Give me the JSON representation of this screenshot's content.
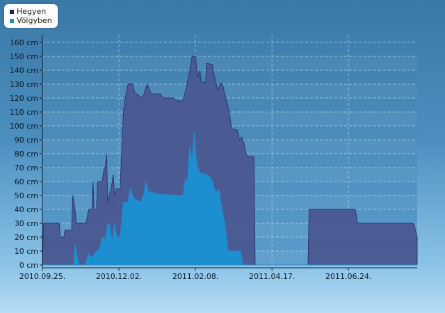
{
  "colors": {
    "hegyen": "#4a5790",
    "hegyen_line": "#2c3670",
    "volgyben": "#1d8fd0",
    "legend_hegyen": "#1a2260",
    "legend_volgyben": "#1d8fd0"
  },
  "legend": [
    {
      "name": "Hegyen",
      "color_key": "legend_hegyen"
    },
    {
      "name": "Völgyben",
      "color_key": "legend_volgyben"
    }
  ],
  "chart_data": {
    "type": "area",
    "ylim": [
      0,
      160
    ],
    "y_ticks": [
      0,
      10,
      20,
      30,
      40,
      50,
      60,
      70,
      80,
      90,
      100,
      110,
      120,
      130,
      140,
      150,
      160
    ],
    "y_tick_labels": [
      "0 cm",
      "10 cm",
      "20 cm",
      "30 cm",
      "40 cm",
      "50 cm",
      "60 cm",
      "70 cm",
      "80 cm",
      "90 cm",
      "100 cm",
      "110 cm",
      "120 cm",
      "130 cm",
      "140 cm",
      "150 cm",
      "160 cm"
    ],
    "x_tick_labels": [
      "2010.09.25.",
      "2010.12.02.",
      "2011.02.08.",
      "2011.04.17.",
      "2011.06.24."
    ],
    "x_range": [
      "2010.09.25.",
      "2011.08.24."
    ],
    "grid": true,
    "legend_position": "top-left",
    "series": [
      {
        "name": "Hegyen",
        "points": [
          [
            "2010.09.25.",
            0
          ],
          [
            "2010.09.26.",
            30
          ],
          [
            "2010.10.10.",
            30
          ],
          [
            "2010.10.11.",
            20
          ],
          [
            "2010.10.14.",
            20
          ],
          [
            "2010.10.15.",
            25
          ],
          [
            "2010.10.21.",
            25
          ],
          [
            "2010.10.22.",
            50
          ],
          [
            "2010.10.24.",
            40
          ],
          [
            "2010.10.25.",
            30
          ],
          [
            "2010.11.03.",
            30
          ],
          [
            "2010.11.05.",
            40
          ],
          [
            "2010.11.08.",
            40
          ],
          [
            "2010.11.09.",
            60
          ],
          [
            "2010.11.10.",
            40
          ],
          [
            "2010.11.12.",
            40
          ],
          [
            "2010.11.13.",
            60
          ],
          [
            "2010.11.17.",
            60
          ],
          [
            "2010.11.19.",
            70
          ],
          [
            "2010.11.20.",
            70
          ],
          [
            "2010.11.21.",
            80
          ],
          [
            "2010.11.22.",
            45
          ],
          [
            "2010.11.25.",
            55
          ],
          [
            "2010.11.27.",
            65
          ],
          [
            "2010.11.28.",
            50
          ],
          [
            "2010.11.30.",
            55
          ],
          [
            "2010.12.03.",
            55
          ],
          [
            "2010.12.06.",
            110
          ],
          [
            "2010.12.08.",
            122
          ],
          [
            "2010.12.10.",
            130
          ],
          [
            "2010.12.14.",
            130
          ],
          [
            "2010.12.16.",
            124
          ],
          [
            "2010.12.23.",
            120
          ],
          [
            "2010.12.25.",
            125
          ],
          [
            "2010.12.27.",
            130
          ],
          [
            "2010.12.29.",
            126
          ],
          [
            "2010.12.31.",
            123
          ],
          [
            "2011.01.08.",
            123
          ],
          [
            "2011.01.10.",
            120
          ],
          [
            "2011.01.20.",
            120
          ],
          [
            "2011.01.22.",
            118
          ],
          [
            "2011.01.28.",
            118
          ],
          [
            "2011.01.31.",
            128
          ],
          [
            "2011.02.03.",
            140
          ],
          [
            "2011.02.05.",
            150
          ],
          [
            "2011.02.08.",
            150
          ],
          [
            "2011.02.10.",
            135
          ],
          [
            "2011.02.12.",
            140
          ],
          [
            "2011.02.13.",
            132
          ],
          [
            "2011.02.17.",
            131
          ],
          [
            "2011.02.18.",
            145
          ],
          [
            "2011.02.23.",
            144
          ],
          [
            "2011.02.25.",
            135
          ],
          [
            "2011.02.28.",
            125
          ],
          [
            "2011.03.02.",
            131
          ],
          [
            "2011.03.04.",
            130
          ],
          [
            "2011.03.07.",
            120
          ],
          [
            "2011.03.10.",
            110
          ],
          [
            "2011.03.12.",
            98
          ],
          [
            "2011.03.17.",
            97
          ],
          [
            "2011.03.19.",
            90
          ],
          [
            "2011.03.21.",
            92
          ],
          [
            "2011.03.23.",
            88
          ],
          [
            "2011.03.25.",
            80
          ],
          [
            "2011.03.27.",
            78
          ],
          [
            "2011.04.01.",
            78
          ],
          [
            "2011.04.02.",
            0
          ],
          [
            "2011.05.19.",
            0
          ],
          [
            "2011.05.20.",
            40
          ],
          [
            "2011.06.30.",
            40
          ],
          [
            "2011.07.02.",
            30
          ],
          [
            "2011.08.21.",
            30
          ],
          [
            "2011.08.24.",
            20
          ]
        ]
      },
      {
        "name": "Völgyben",
        "points": [
          [
            "2010.09.25.",
            0
          ],
          [
            "2010.10.23.",
            0
          ],
          [
            "2010.10.24.",
            15
          ],
          [
            "2010.10.26.",
            5
          ],
          [
            "2010.10.28.",
            0
          ],
          [
            "2010.11.02.",
            0
          ],
          [
            "2010.11.05.",
            8
          ],
          [
            "2010.11.08.",
            5
          ],
          [
            "2010.11.12.",
            10
          ],
          [
            "2010.11.15.",
            12
          ],
          [
            "2010.11.17.",
            20
          ],
          [
            "2010.11.20.",
            18
          ],
          [
            "2010.11.22.",
            30
          ],
          [
            "2010.11.24.",
            28
          ],
          [
            "2010.11.26.",
            15
          ],
          [
            "2010.11.28.",
            30
          ],
          [
            "2010.11.30.",
            20
          ],
          [
            "2010.12.03.",
            20
          ],
          [
            "2010.12.06.",
            45
          ],
          [
            "2010.12.10.",
            45
          ],
          [
            "2010.12.12.",
            55
          ],
          [
            "2010.12.15.",
            48
          ],
          [
            "2010.12.21.",
            45
          ],
          [
            "2010.12.24.",
            50
          ],
          [
            "2010.12.26.",
            60
          ],
          [
            "2010.12.28.",
            53
          ],
          [
            "2011.01.05.",
            51
          ],
          [
            "2011.01.25.",
            50
          ],
          [
            "2011.01.28.",
            50
          ],
          [
            "2011.01.30.",
            62
          ],
          [
            "2011.02.01.",
            60
          ],
          [
            "2011.02.03.",
            85
          ],
          [
            "2011.02.05.",
            75
          ],
          [
            "2011.02.07.",
            95
          ],
          [
            "2011.02.09.",
            72
          ],
          [
            "2011.02.12.",
            66
          ],
          [
            "2011.02.18.",
            65
          ],
          [
            "2011.02.22.",
            62
          ],
          [
            "2011.02.26.",
            52
          ],
          [
            "2011.03.01.",
            54
          ],
          [
            "2011.03.03.",
            42
          ],
          [
            "2011.03.06.",
            30
          ],
          [
            "2011.03.09.",
            10
          ],
          [
            "2011.03.20.",
            10
          ],
          [
            "2011.03.22.",
            0
          ],
          [
            "2011.08.24.",
            0
          ]
        ]
      }
    ]
  }
}
